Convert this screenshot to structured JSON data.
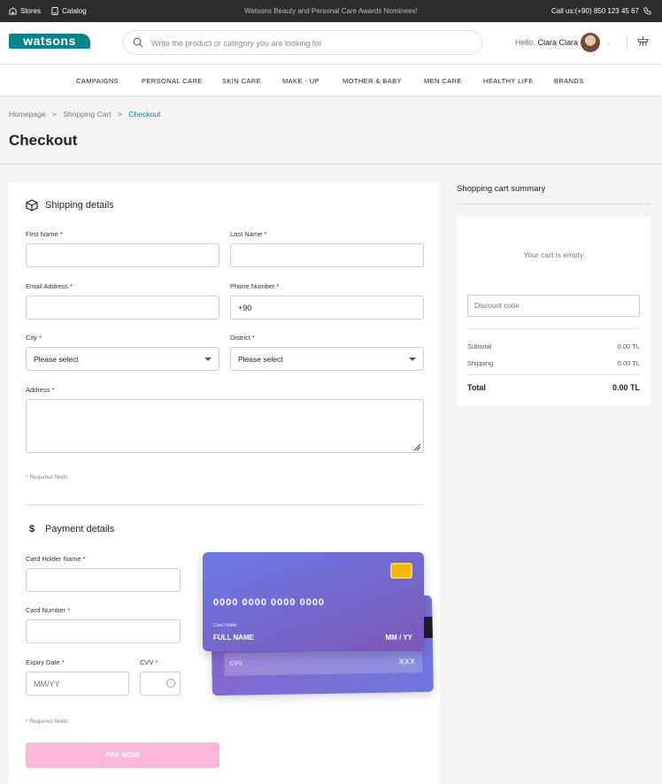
{
  "topbar": {
    "stores": "Stores",
    "catalog": "Catalog",
    "announcement": "Watsons Beauty and Personal Care Awards Nominees!",
    "call": "Call us:(+90) 850 123 45 67"
  },
  "header": {
    "logo": "watsons",
    "search_placeholder": "Write the product or category you are looking for",
    "hello": "Hello,",
    "user_name": "Clara Clara",
    "brand_color": "#05858a"
  },
  "nav": [
    "CAMPAIGNS",
    "PERSONAL CARE",
    "SKIN CARE",
    "MAKE - UP",
    "MOTHER & BABY",
    "MEN CARE",
    "HEALTHY LIFE",
    "BRANDS"
  ],
  "breadcrumb": {
    "home": "Homepage",
    "cart": "Shopping Cart",
    "current": "Checkout",
    "sep": ">"
  },
  "page_title": "Checkout",
  "shipping": {
    "title": "Shipping details",
    "first_name_label": "First Name *",
    "last_name_label": "Last Name *",
    "email_label": "Email Address *",
    "phone_label": "Phone Number *",
    "phone_value": "+90",
    "city_label": "City *",
    "city_value": "Please select",
    "district_label": "District *",
    "district_value": "Please select",
    "address_label": "Address *",
    "required_note": "* Required fields"
  },
  "payment": {
    "title": "Payment details",
    "icon_symbol": "$",
    "holder_label": "Card Holder Name *",
    "number_label": "Card Number *",
    "expiry_label": "Expiry Date *",
    "expiry_placeholder": "MM/YY",
    "cvv_label": "CVV *",
    "required_note": "* Required fields",
    "pay_button": "PAY NOW",
    "pay_button_color": "#ffb7d8"
  },
  "card_preview": {
    "number": "0000 0000 0000 0000",
    "holder_caption": "Card Holder",
    "holder_name": "FULL NAME",
    "expiry": "MM / YY",
    "cvv_label": "CVV",
    "cvv_value": "XXX"
  },
  "summary": {
    "title": "Shopping cart summary",
    "empty_text": "Your cart is empty",
    "discount_placeholder": "Discount code",
    "subtotal_label": "Subtotal",
    "subtotal_value": "0.00 TL",
    "shipping_label": "Shipping",
    "shipping_value": "0.00 TL",
    "total_label": "Total",
    "total_value": "0.00 TL"
  }
}
